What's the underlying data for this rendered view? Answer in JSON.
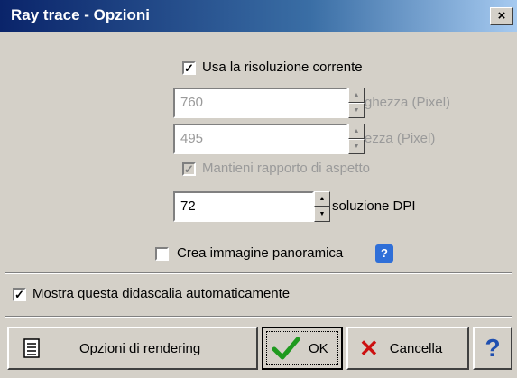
{
  "window": {
    "title": "Ray trace - Opzioni",
    "close_label": "×"
  },
  "options": {
    "use_current_resolution": {
      "label": "Usa la risoluzione corrente",
      "checked": true
    },
    "width": {
      "value": "760",
      "label": "ghezza (Pixel)"
    },
    "height": {
      "value": "495",
      "label": "ezza (Pixel)"
    },
    "keep_aspect": {
      "label": "Mantieni rapporto di aspetto",
      "checked": true
    },
    "dpi": {
      "value": "72",
      "label": "soluzione DPI"
    },
    "panoramic": {
      "label": "Crea immagine panoramica",
      "checked": false,
      "help_label": "?"
    },
    "show_tooltip": {
      "label": "Mostra questa didascalia automaticamente",
      "checked": true
    }
  },
  "buttons": {
    "rendering": "Opzioni di rendering",
    "ok": "OK",
    "cancel": "Cancella",
    "help": "?"
  },
  "colors": {
    "titlebar": "#0a246a",
    "ok_check": "#1f9a1f",
    "cancel_x": "#cc1010",
    "help": "#1f4fb0"
  }
}
